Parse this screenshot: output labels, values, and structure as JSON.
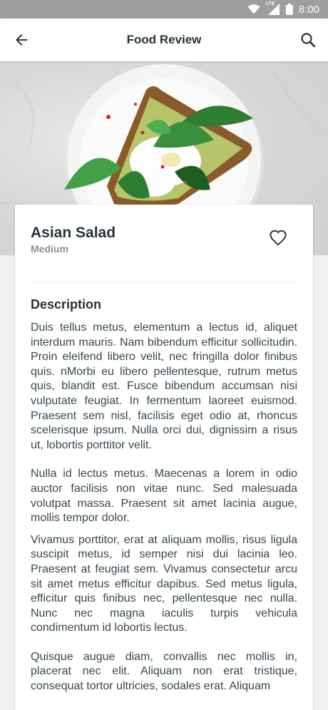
{
  "status": {
    "time": "8:00",
    "lte": "LTE"
  },
  "header": {
    "title": "Food Review"
  },
  "dish": {
    "name": "Asian Salad",
    "level": "Medium"
  },
  "description": {
    "title": "Description",
    "paragraphs": [
      "Duis tellus metus, elementum a lectus id, aliquet interdum mauris. Nam bibendum efficitur sollicitudin. Proin eleifend libero velit, nec fringilla dolor finibus quis. nMorbi eu libero pellentesque, rutrum metus quis, blandit est. Fusce bibendum accumsan nisi vulputate feugiat. In fermentum laoreet euismod. Praesent sem nisl, facilisis eget odio at, rhoncus scelerisque ipsum. Nulla orci dui, dignissim a risus ut, lobortis porttitor velit.",
      "Nulla id lectus metus. Maecenas a lorem in odio auctor facilisis non vitae nunc. Sed malesuada volutpat massa. Praesent sit amet lacinia augue, mollis tempor dolor.",
      "Vivamus porttitor, erat at aliquam mollis, risus ligula suscipit metus, id semper nisi dui lacinia leo. Praesent at feugiat sem. Vivamus consectetur arcu sit amet metus efficitur dapibus. Sed metus ligula, efficitur quis finibus nec, pellentesque nec nulla. Nunc nec magna iaculis turpis vehicula condimentum id lobortis lectus.",
      "Quisque augue diam, convallis nec mollis in, placerat nec elit. Aliquam non erat tristique, consequat tortor ultricies, sodales erat. Aliquam"
    ]
  },
  "icons": {
    "back": "arrow-back-icon",
    "search": "search-icon",
    "favorite": "heart-outline-icon",
    "wifi": "wifi-icon",
    "signal": "signal-icon",
    "battery": "battery-icon"
  },
  "colors": {
    "title": "#263238",
    "body_text": "#37474f",
    "muted": "#8a8f94",
    "status_bar": "#9e9e9e"
  }
}
